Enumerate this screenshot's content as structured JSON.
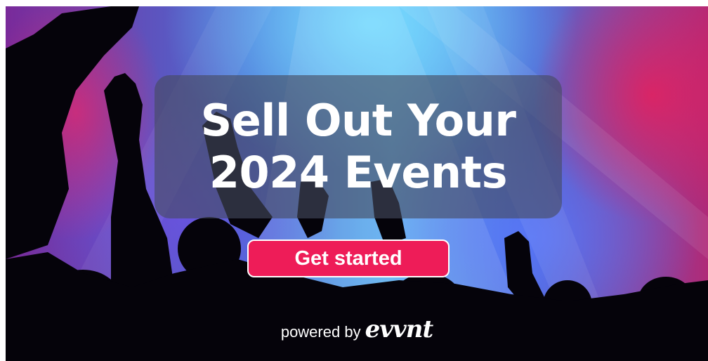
{
  "banner": {
    "headline_line1": "Sell Out Your",
    "headline_line2": "2024 Events",
    "cta_label": "Get started",
    "powered_by": "powered by",
    "brand": "evvnt"
  },
  "colors": {
    "cta_background": "#ee1c58",
    "headline_box": "rgba(70,75,95,0.62)",
    "text": "#ffffff"
  }
}
